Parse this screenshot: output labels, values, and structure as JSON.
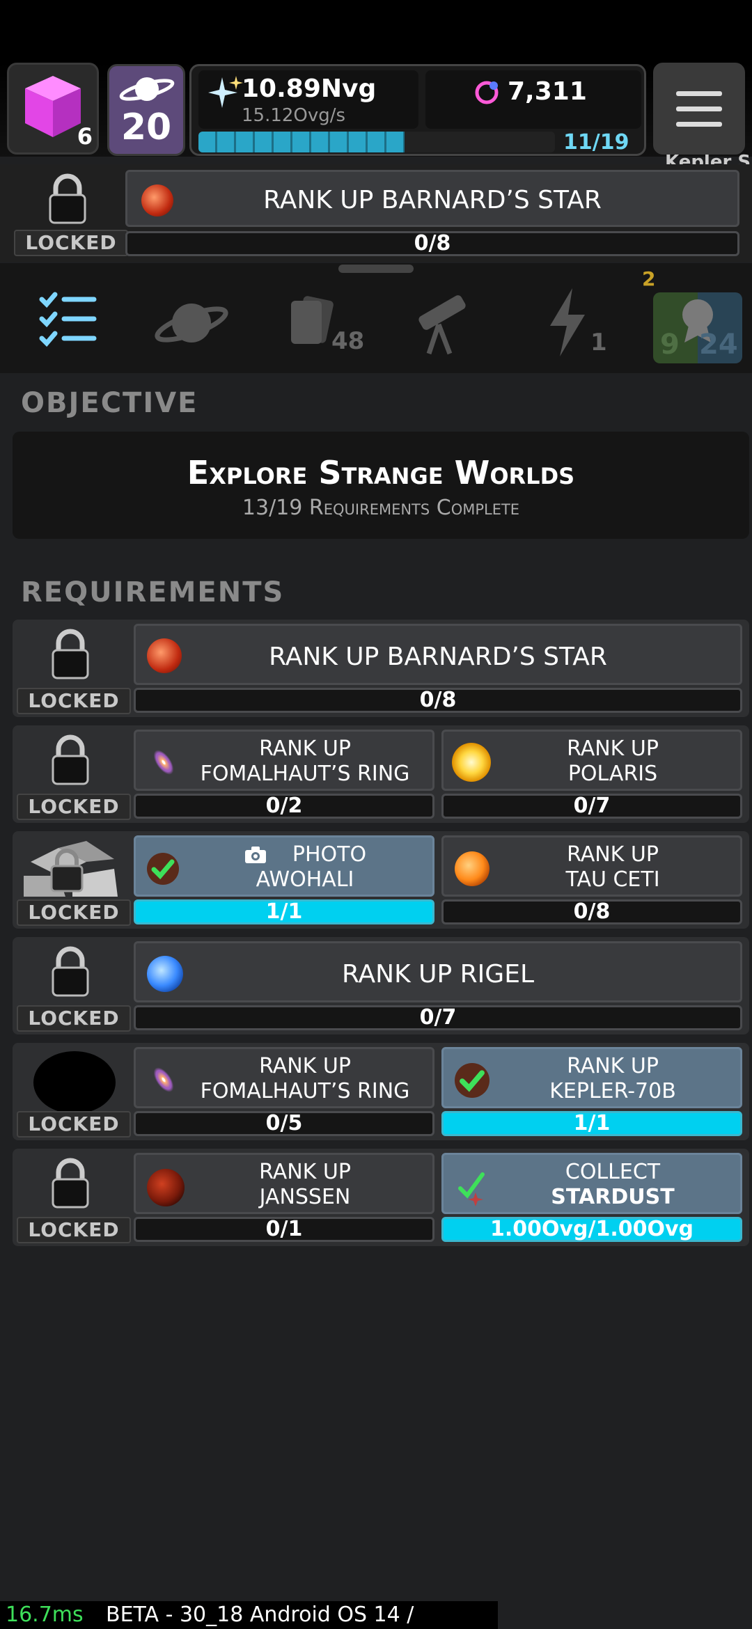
{
  "header": {
    "cube_count": "6",
    "level": "20",
    "nvg_amount": "10.89Nvg",
    "nvg_rate": "15.12Ovg/s",
    "orb_amount": "7,311",
    "progress_label": "11/19",
    "progress_fraction": 0.579,
    "bg_star_label": "Kepler S"
  },
  "pinned": {
    "title": "RANK UP BARNARD’S STAR",
    "progress": "0/8",
    "locked_label": "LOCKED"
  },
  "tabs": [
    {
      "icon": "checklist-icon",
      "badge": ""
    },
    {
      "icon": "planet-icon",
      "badge": ""
    },
    {
      "icon": "cards-icon",
      "badge": "48"
    },
    {
      "icon": "telescope-icon",
      "badge": ""
    },
    {
      "icon": "lightning-icon",
      "badge": "1"
    },
    {
      "icon": "award-icon",
      "badge_left": "9",
      "badge_right": "24",
      "crown": "2"
    }
  ],
  "objective": {
    "heading": "OBJECTIVE",
    "title": "Explore Strange Worlds",
    "subtitle": "13/19 Requirements Complete"
  },
  "requirements": {
    "heading": "REQUIREMENTS",
    "locked_label": "LOCKED",
    "rows": [
      {
        "cards": [
          {
            "line1": "RANK UP BARNARD’S STAR",
            "line2": "",
            "progress": "0/8",
            "done": false
          }
        ]
      },
      {
        "cards": [
          {
            "line1": "RANK UP",
            "line2": "FOMALHAUT’S RING",
            "progress": "0/2",
            "done": false
          },
          {
            "line1": "RANK UP",
            "line2": "POLARIS",
            "progress": "0/7",
            "done": false
          }
        ]
      },
      {
        "cards": [
          {
            "line1": "PHOTO",
            "line2": "AWOHALI",
            "progress": "1/1",
            "done": true
          },
          {
            "line1": "RANK UP",
            "line2": "TAU CETI",
            "progress": "0/8",
            "done": false
          }
        ]
      },
      {
        "cards": [
          {
            "line1": "RANK UP RIGEL",
            "line2": "",
            "progress": "0/7",
            "done": false
          }
        ]
      },
      {
        "cards": [
          {
            "line1": "RANK UP",
            "line2": "FOMALHAUT’S RING",
            "progress": "0/5",
            "done": false
          },
          {
            "line1": "RANK UP",
            "line2": "KEPLER-70B",
            "progress": "1/1",
            "done": true
          }
        ]
      },
      {
        "cards": [
          {
            "line1": "RANK UP",
            "line2": "JANSSEN",
            "progress": "0/1",
            "done": false
          },
          {
            "line1": "COLLECT",
            "line2": "STARDUST",
            "progress": "1.00Ovg/1.00Ovg",
            "done": true
          }
        ]
      }
    ]
  },
  "debug": {
    "frame_time": "16.7ms",
    "build": "BETA - 30_18 Android OS 14 /"
  },
  "colors": {
    "accent_cyan": "#00d0f0",
    "done_card": "#5c7488",
    "level_tile": "#5d4a7a",
    "cube": "#ff4fff"
  }
}
